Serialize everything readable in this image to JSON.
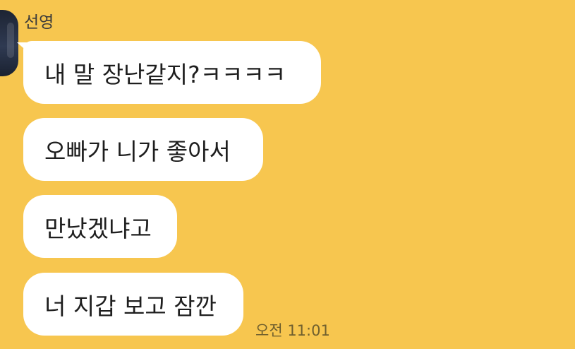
{
  "chat": {
    "sender": "선영",
    "messages": [
      "내 말 장난같지?ㅋㅋㅋㅋ",
      "오빠가 니가 좋아서",
      "만났겠냐고",
      "너 지갑 보고 잠깐"
    ],
    "time": "오전 11:01"
  },
  "colors": {
    "background": "#f7c64f",
    "bubble": "#ffffff"
  }
}
